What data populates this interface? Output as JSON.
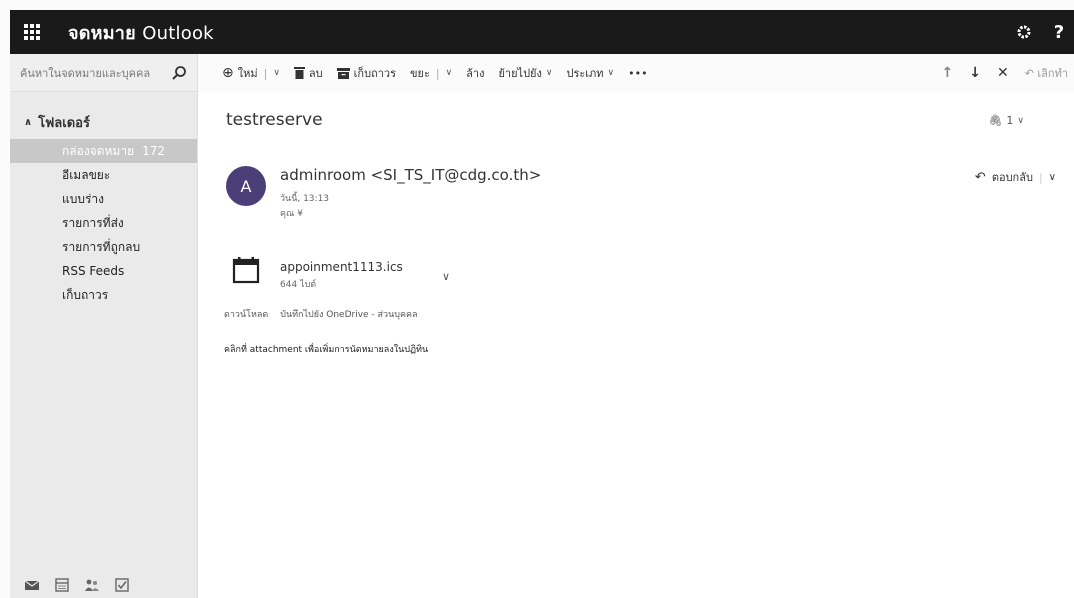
{
  "header": {
    "app_name_bold": "จดหมาย",
    "app_name_light": "Outlook",
    "settings_icon": "gear-icon",
    "help_label": "?"
  },
  "search": {
    "placeholder": "ค้นหาในจดหมายและบุคคล"
  },
  "folders": {
    "heading": "โฟลเดอร์",
    "items": [
      {
        "label": "กล่องจดหมาย",
        "count": "172",
        "selected": true
      },
      {
        "label": "อีเมลขยะ"
      },
      {
        "label": "แบบร่าง"
      },
      {
        "label": "รายการที่ส่ง"
      },
      {
        "label": "รายการที่ถูกลบ"
      },
      {
        "label": "RSS Feeds"
      },
      {
        "label": "เก็บถาวร"
      }
    ]
  },
  "toolbar": {
    "new_label": "ใหม่",
    "delete_label": "ลบ",
    "archive_label": "เก็บถาวร",
    "junk_label": "ขยะ",
    "sweep_label": "ล้าง",
    "move_label": "ย้ายไปยัง",
    "categories_label": "ประเภท",
    "more_label": "•••",
    "undo_label": "เลิกทำ"
  },
  "message": {
    "subject": "testreserve",
    "attachment_count": "1",
    "avatar_initial": "A",
    "sender": "adminroom <SI_TS_IT@cdg.co.th>",
    "time": "วันนี้, 13:13",
    "recipient": "คุณ ¥",
    "reply_label": "ตอบกลับ",
    "attachment": {
      "name": "appoinment1113.ics",
      "size": "644 ไบต์",
      "download_label": "ดาวน์โหลด",
      "save_label": "บันทึกไปยัง OneDrive - ส่วนบุคคล"
    },
    "body": "คลิกที่ attachment เพื่อเพิ่มการนัดหมายลงในปฏิทิน"
  }
}
